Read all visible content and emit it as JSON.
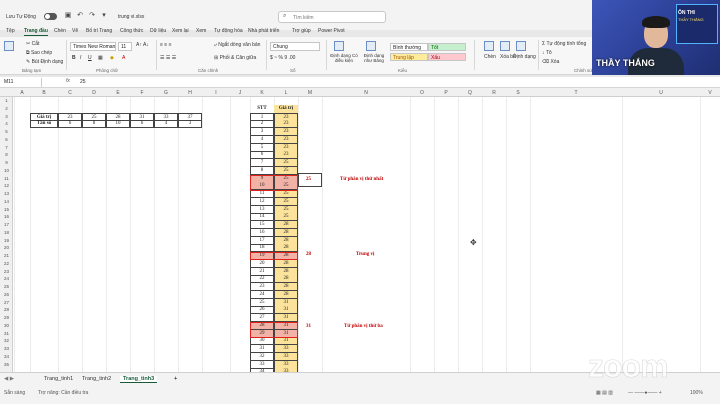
{
  "titlebar": {
    "autosave": "Lưu Tự Động",
    "filename": "trung vi.xlsx",
    "search_placeholder": "Tìm kiếm"
  },
  "menu_tabs": [
    "Tệp",
    "Trang đầu",
    "Chèn",
    "Vẽ",
    "Bố trí Trang",
    "Công thức",
    "Dữ liệu",
    "Xem lại",
    "Xem",
    "Tự động hóa",
    "Nhà phát triển",
    "Trợ giúp",
    "Power Pivot"
  ],
  "ribbon": {
    "clipboard": {
      "cut": "Cắt",
      "copy": "Sao chép",
      "format_painter": "Bút Định dạng",
      "group": "Bảng tạm"
    },
    "font": {
      "name": "Times New Roman",
      "size": "11",
      "group": "Phông chữ"
    },
    "alignment": {
      "wrap": "Ngắt dòng văn bản",
      "merge": "Phối & Căn giữa",
      "group": "Căn chỉnh"
    },
    "number": {
      "format": "Chung",
      "group": "Số"
    },
    "styles": {
      "conditional": "Định dạng Có điều kiện",
      "as_table": "Định dạng như Bảng",
      "normal": "Bình thường",
      "good": "Tốt",
      "neutral": "Trung lập",
      "bad": "Xấu",
      "group": "Kiểu"
    },
    "cells": {
      "insert": "Chèn",
      "delete": "Xóa bỏ",
      "format": "Định dạng"
    },
    "editing": {
      "autosum": "Σ Tự động tính tổng",
      "fill": "Tô",
      "clear": "Xóa",
      "group": "Chỉnh sửa"
    }
  },
  "formula_bar": {
    "name_box": "M11",
    "fx": "fx",
    "value": "25"
  },
  "columns": [
    "A",
    "B",
    "C",
    "D",
    "E",
    "F",
    "G",
    "H",
    "I",
    "J",
    "K",
    "L",
    "M",
    "N",
    "O",
    "P",
    "Q",
    "R",
    "S",
    "T",
    "U",
    "V"
  ],
  "rows": [
    "1",
    "2",
    "3",
    "4",
    "5",
    "6",
    "7",
    "8",
    "9",
    "10",
    "11",
    "12",
    "13",
    "14",
    "15",
    "16",
    "17",
    "18",
    "19",
    "20",
    "21",
    "22",
    "23",
    "24",
    "25",
    "26",
    "27",
    "28",
    "29",
    "30",
    "31",
    "32",
    "33",
    "34",
    "35"
  ],
  "freq_table": {
    "label_value": "Giá trị",
    "label_freq": "Tần số",
    "values": [
      "23",
      "25",
      "28",
      "31",
      "33",
      "37"
    ],
    "freqs": [
      "6",
      "8",
      "10",
      "6",
      "4",
      "3"
    ]
  },
  "list_table": {
    "header_stt": "STT",
    "header_value": "Giá trị",
    "stt": [
      "1",
      "2",
      "3",
      "4",
      "5",
      "6",
      "7",
      "8",
      "9",
      "10",
      "11",
      "12",
      "13",
      "14",
      "15",
      "16",
      "17",
      "18",
      "19",
      "20",
      "21",
      "22",
      "23",
      "24",
      "25",
      "26",
      "27",
      "28",
      "29",
      "30",
      "31",
      "32",
      "33",
      "34"
    ],
    "values": [
      "23",
      "23",
      "23",
      "23",
      "23",
      "23",
      "25",
      "25",
      "25",
      "25",
      "25",
      "25",
      "25",
      "25",
      "28",
      "28",
      "28",
      "28",
      "28",
      "28",
      "28",
      "28",
      "28",
      "28",
      "31",
      "31",
      "31",
      "31",
      "31",
      "31",
      "33",
      "33",
      "33",
      "33"
    ]
  },
  "annotations": {
    "q1_value": "25",
    "q1_label": "Tứ phân vị thứ nhất",
    "q2_value": "28",
    "q2_label": "Trung vị",
    "q3_value": "31",
    "q3_label": "Tứ phân vị thứ ba"
  },
  "sheet_tabs": [
    "Trang_tinh1",
    "Trang_tinh2",
    "Trang_tinh3"
  ],
  "active_sheet": "Trang_tinh3",
  "status": {
    "ready": "Sẵn sàng",
    "accessibility": "Trợ năng: Cần điều tra",
    "zoom": "100%"
  },
  "watermark": "zoom",
  "webcam": {
    "name": "THẦY THẮNG",
    "poster_line1": "ÔN THI",
    "poster_line2": "THẦY THẮNG"
  },
  "colors": {
    "accent": "#185c37",
    "highlight": "#fbe39b",
    "marked": "#f3b2a6",
    "annotation": "#c00000"
  }
}
